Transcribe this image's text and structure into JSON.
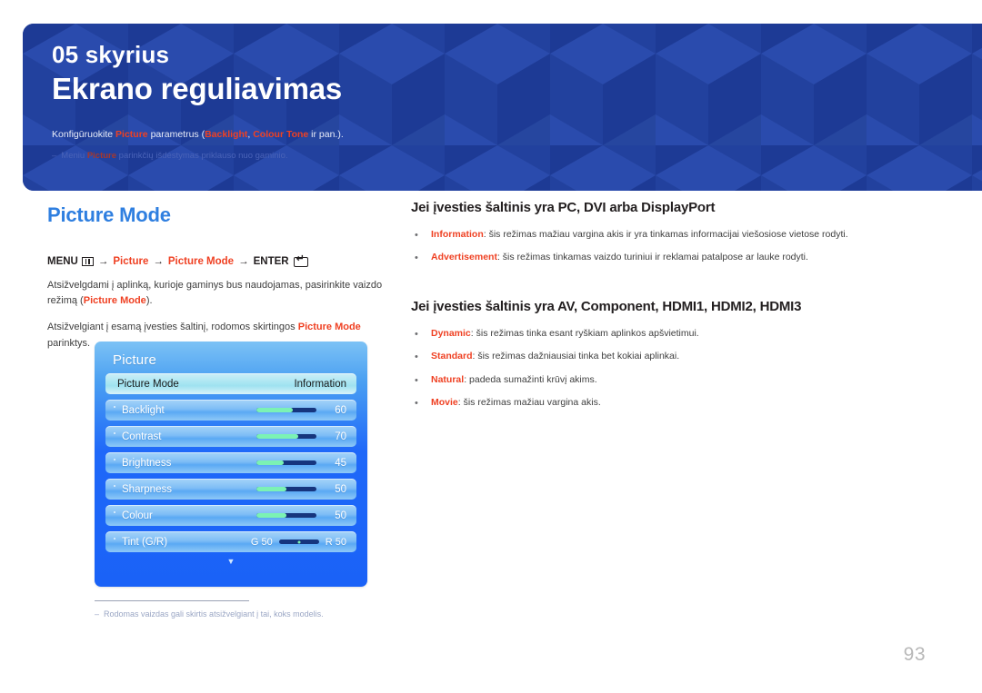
{
  "banner": {
    "chapter_number": "05 skyrius",
    "chapter_title": "Ekrano reguliavimas",
    "description_pre": "Konfigūruokite ",
    "description_kw1": "Picture",
    "description_mid": " parametrus (",
    "description_kw2": "Backlight",
    "description_sep": ", ",
    "description_kw3": "Colour Tone",
    "description_post": " ir pan.).",
    "note_dash": "–",
    "note_pre": "Meniu ",
    "note_kw": "Picture",
    "note_post": " parinkčių išdėstymas priklauso nuo gaminio.",
    "accent_red": "#ef4123",
    "banner_blue": "#1f3d9c"
  },
  "left": {
    "heading": "Picture Mode",
    "heading_color": "#2f7fe0",
    "menu_path": {
      "menu_label": "MENU",
      "arrow": "→",
      "item1": "Picture",
      "item2": "Picture Mode",
      "enter_label": "ENTER"
    },
    "paragraph1_a": "Atsižvelgdami į aplinką, kurioje gaminys bus naudojamas, pasirinkite vaizdo režimą (",
    "paragraph1_kw": "Picture Mode",
    "paragraph1_b": ").",
    "paragraph2_a": "Atsižvelgiant į esamą įvesties šaltinį, rodomos skirtingos ",
    "paragraph2_kw": "Picture Mode",
    "paragraph2_b": " parinktys.",
    "footnote_dash": "–",
    "footnote": "Rodomas vaizdas gali skirtis atsižvelgiant į tai, koks modelis."
  },
  "tv_menu": {
    "title": "Picture",
    "rows": [
      {
        "label": "Picture Mode",
        "value": "Information",
        "type": "selected"
      },
      {
        "label": "Backlight",
        "value": "60",
        "type": "slider",
        "fill_percent": 60
      },
      {
        "label": "Contrast",
        "value": "70",
        "type": "slider",
        "fill_percent": 70
      },
      {
        "label": "Brightness",
        "value": "45",
        "type": "slider",
        "fill_percent": 45
      },
      {
        "label": "Sharpness",
        "value": "50",
        "type": "slider",
        "fill_percent": 50
      },
      {
        "label": "Colour",
        "value": "50",
        "type": "slider",
        "fill_percent": 50
      },
      {
        "label": "Tint (G/R)",
        "value_left": "G 50",
        "value_right": "R 50",
        "type": "tint"
      }
    ],
    "more_arrow": "▼"
  },
  "right": {
    "section1": {
      "heading": "Jei įvesties šaltinis yra PC, DVI arba DisplayPort",
      "bullet_char": "•",
      "items": [
        {
          "term": "Information",
          "desc": ": šis režimas mažiau vargina akis ir yra tinkamas informacijai viešosiose vietose rodyti."
        },
        {
          "term": "Advertisement",
          "desc": ": šis režimas tinkamas vaizdo turiniui ir reklamai patalpose ar lauke rodyti."
        }
      ]
    },
    "section2": {
      "heading": "Jei įvesties šaltinis yra AV, Component, HDMI1, HDMI2, HDMI3",
      "bullet_char": "•",
      "items": [
        {
          "term": "Dynamic",
          "desc": ": šis režimas tinka esant ryškiam aplinkos apšvietimui."
        },
        {
          "term": "Standard",
          "desc": ": šis režimas dažniausiai tinka bet kokiai aplinkai."
        },
        {
          "term": "Natural",
          "desc": ": padeda sumažinti krūvį akims."
        },
        {
          "term": "Movie",
          "desc": ": šis režimas mažiau vargina akis."
        }
      ]
    }
  },
  "page_number": "93"
}
